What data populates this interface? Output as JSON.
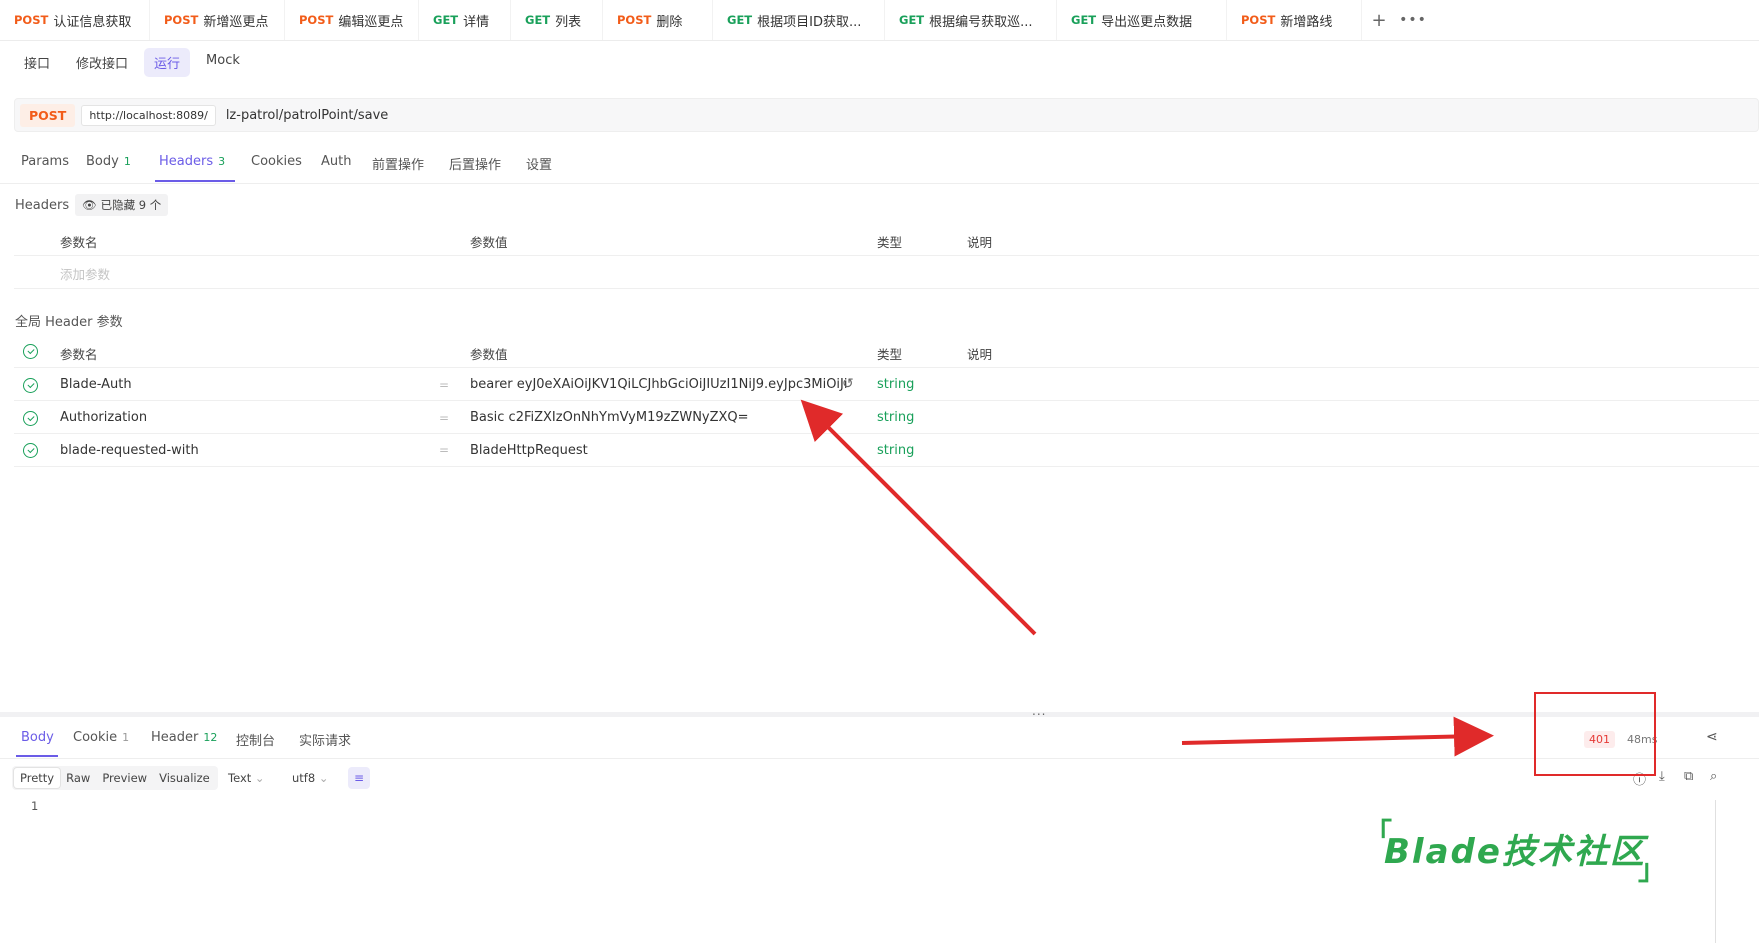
{
  "tabs": [
    {
      "method": "POST",
      "label": "认证信息获取"
    },
    {
      "method": "POST",
      "label": "新增巡更点",
      "active": true
    },
    {
      "method": "POST",
      "label": "编辑巡更点"
    },
    {
      "method": "GET",
      "label": "详情"
    },
    {
      "method": "GET",
      "label": "列表"
    },
    {
      "method": "POST",
      "label": "删除"
    },
    {
      "method": "GET",
      "label": "根据项目ID获取..."
    },
    {
      "method": "GET",
      "label": "根据编号获取巡..."
    },
    {
      "method": "GET",
      "label": "导出巡更点数据"
    },
    {
      "method": "POST",
      "label": "新增路线"
    }
  ],
  "tabbar_icons": {
    "add": "plus-icon",
    "more": "more-icon"
  },
  "subnav": [
    "接口",
    "修改接口",
    "运行",
    "Mock"
  ],
  "subnav_active": "运行",
  "request": {
    "method": "POST",
    "base_url": "http://localhost:8089/",
    "path": "lz-patrol/patrolPoint/save"
  },
  "request_tabs": [
    {
      "label": "Params"
    },
    {
      "label": "Body",
      "count": "1"
    },
    {
      "label": "Headers",
      "count": "3",
      "active": true
    },
    {
      "label": "Cookies"
    },
    {
      "label": "Auth"
    },
    {
      "label": "前置操作"
    },
    {
      "label": "后置操作"
    },
    {
      "label": "设置"
    }
  ],
  "headers": {
    "section_label": "Headers",
    "hidden_badge": "已隐藏 9 个",
    "columns": [
      "参数名",
      "参数值",
      "类型",
      "说明"
    ],
    "add_placeholder": "添加参数"
  },
  "global_headers": {
    "section_label": "全局 Header 参数",
    "columns": [
      "参数名",
      "参数值",
      "类型",
      "说明"
    ],
    "rows": [
      {
        "name": "Blade-Auth",
        "value": "bearer eyJ0eXAiOiJKV1QiLCJhbGciOiJIUzI1NiJ9.eyJpc3MiOiJi",
        "type": "string"
      },
      {
        "name": "Authorization",
        "value": "Basic c2FiZXIzOnNhYmVyM19zZWNyZXQ=",
        "type": "string"
      },
      {
        "name": "blade-requested-with",
        "value": "BladeHttpRequest",
        "type": "string"
      }
    ]
  },
  "splitter_dots": "...",
  "response": {
    "tabs": [
      {
        "label": "Body",
        "active": true
      },
      {
        "label": "Cookie",
        "count": "1"
      },
      {
        "label": "Header",
        "count": "12"
      },
      {
        "label": "控制台"
      },
      {
        "label": "实际请求"
      }
    ],
    "status": "401",
    "time": "48ms",
    "format_tabs": [
      "Pretty",
      "Raw",
      "Preview",
      "Visualize"
    ],
    "format_active": "Pretty",
    "text_mode": "Text",
    "encoding": "utf8",
    "line_number": "1"
  },
  "watermark": "Blade技术社区",
  "colors": {
    "accent": "#6b5ce7",
    "post": "#f25c19",
    "get": "#19a05a",
    "annotation": "#e02a2a"
  }
}
